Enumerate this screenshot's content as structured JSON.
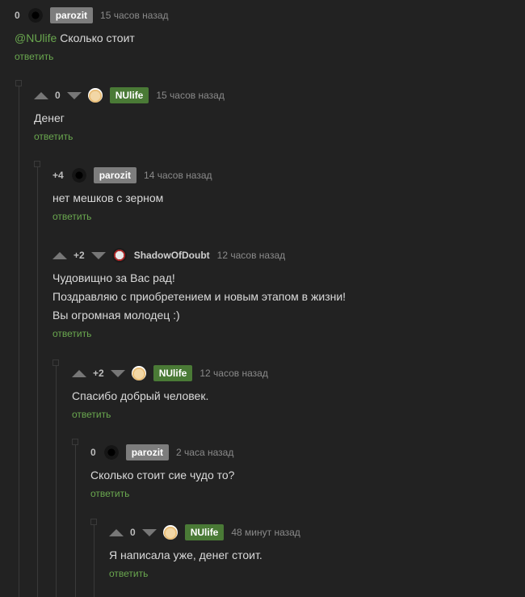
{
  "comments": [
    {
      "rating": "0",
      "user": "parozit",
      "time": "15 часов назад",
      "mention": "@NUlife",
      "text": " Сколько стоит",
      "reply": "ответить"
    },
    {
      "rating": "0",
      "user": "NUlife",
      "time": "15 часов назад",
      "text": "Денег",
      "reply": "ответить"
    },
    {
      "rating": "+4",
      "user": "parozit",
      "time": "14 часов назад",
      "text": "нет мешков с зерном",
      "reply": "ответить"
    },
    {
      "rating": "+2",
      "user": "ShadowOfDoubt",
      "time": "12 часов назад",
      "lines": [
        "Чудовищно за Вас рад!",
        "Поздравляю с приобретением и новым этапом в жизни!",
        "Вы огромная молодец :)"
      ],
      "reply": "ответить"
    },
    {
      "rating": "+2",
      "user": "NUlife",
      "time": "12 часов назад",
      "text": "Спасибо добрый человек.",
      "reply": "ответить"
    },
    {
      "rating": "0",
      "user": "parozit",
      "time": "2 часа назад",
      "text": "Сколько стоит сие чудо то?",
      "reply": "ответить"
    },
    {
      "rating": "0",
      "user": "NUlife",
      "time": "48 минут назад",
      "text": "Я написала уже, денег стоит.",
      "reply": "ответить"
    }
  ]
}
